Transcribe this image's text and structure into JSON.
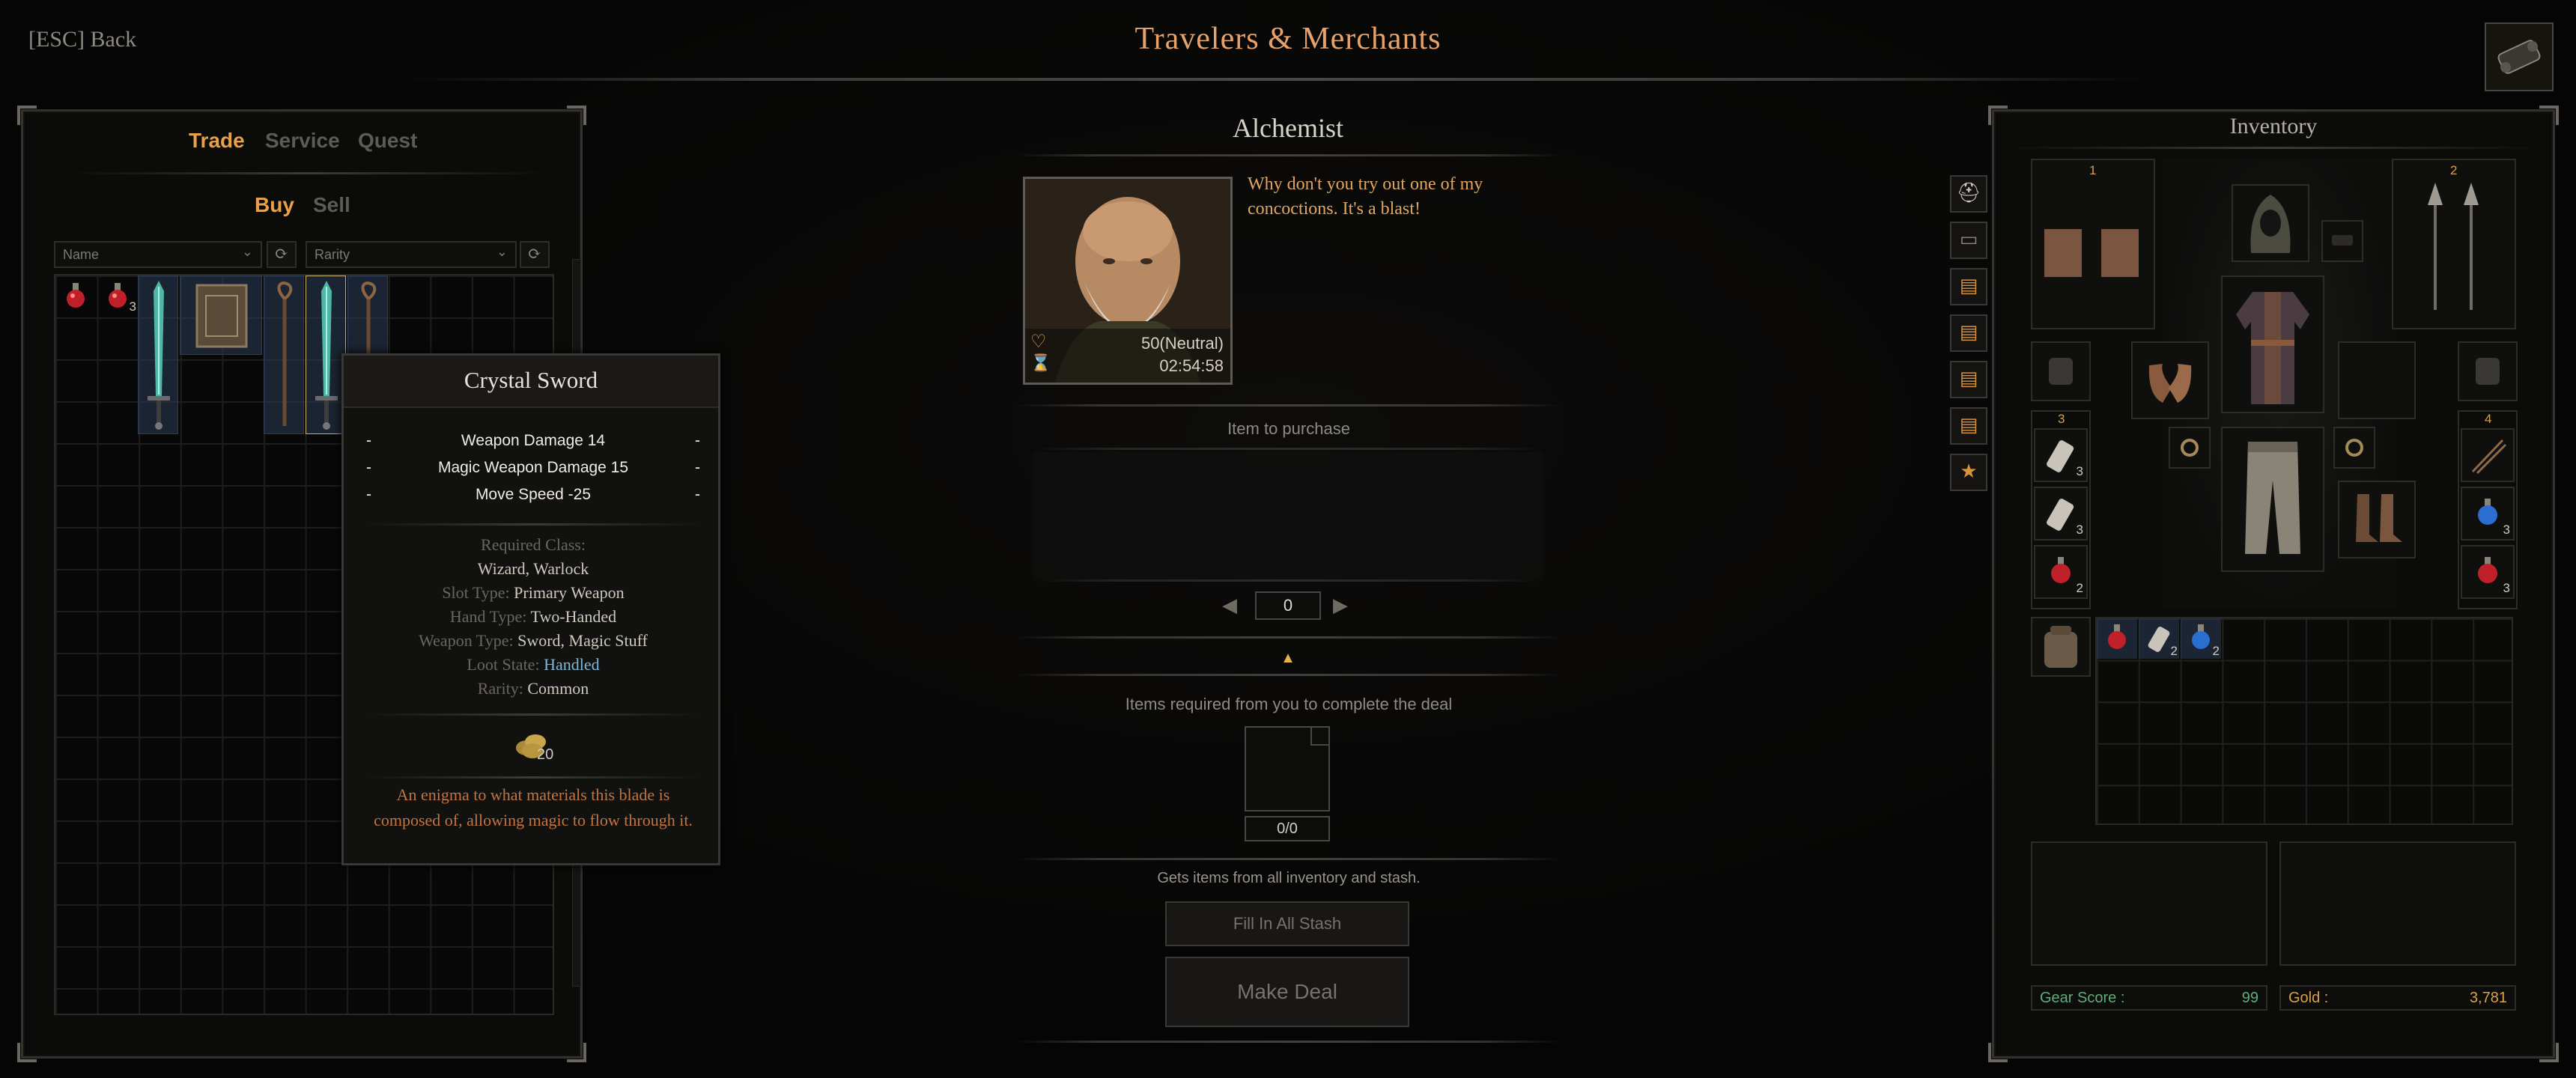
{
  "header": {
    "back_label": "[ESC] Back",
    "title": "Travelers & Merchants"
  },
  "left_panel": {
    "tabs": [
      {
        "label": "Trade",
        "active": true
      },
      {
        "label": "Service"
      },
      {
        "label": "Quest"
      }
    ],
    "subtabs": [
      {
        "label": "Buy",
        "active": true
      },
      {
        "label": "Sell"
      }
    ],
    "filter_name": "Name",
    "filter_rarity": "Rarity",
    "items": [
      {
        "icon": "red-potion-icon"
      },
      {
        "icon": "red-potion-icon",
        "count": "3"
      },
      {
        "icon": "crystal-sword-icon"
      },
      {
        "icon": "spellbook-icon"
      },
      {
        "icon": "staff-icon"
      },
      {
        "icon": "crystal-sword-icon"
      },
      {
        "icon": "staff-icon"
      }
    ]
  },
  "tooltip": {
    "title": "Crystal Sword",
    "stats": [
      "Weapon Damage 14",
      "Magic Weapon Damage 15",
      "Move Speed -25"
    ],
    "required_class_label": "Required Class:",
    "required_class_value": "Wizard, Warlock",
    "rows": [
      {
        "label": "Slot Type:",
        "value": "Primary Weapon"
      },
      {
        "label": "Hand Type:",
        "value": "Two-Handed"
      },
      {
        "label": "Weapon Type:",
        "value": "Sword, Magic Stuff"
      },
      {
        "label": "Loot State:",
        "value": "Handled",
        "color": "#7fb7d6"
      },
      {
        "label": "Rarity:",
        "value": "Common"
      }
    ],
    "price": "20",
    "description": "An enigma to what materials this blade is composed of, allowing magic to flow through it."
  },
  "merchant": {
    "name": "Alchemist",
    "dialogue": "Why don't you try out one of my concoctions. It's a blast!",
    "affinity": "50(Neutral)",
    "timer": "02:54:58",
    "item_to_purchase_label": "Item to purchase",
    "quantity": "0",
    "required_label": "Items required from you to complete the deal",
    "required_count": "0/0",
    "source_note": "Gets items from all inventory and stash.",
    "fill_button": "Fill In All Stash",
    "deal_button": "Make Deal"
  },
  "inventory": {
    "title": "Inventory",
    "weapon_slot_1": "1",
    "weapon_slot_2": "2",
    "utility_left_label": "3",
    "utility_right_label": "4",
    "utility_left": [
      {
        "icon": "bandage-icon",
        "count": "3"
      },
      {
        "icon": "bandage-icon",
        "count": "3"
      },
      {
        "icon": "red-potion-icon",
        "count": "2"
      }
    ],
    "utility_right": [
      {
        "icon": "arrows-icon"
      },
      {
        "icon": "blue-potion-icon",
        "count": "3"
      },
      {
        "icon": "red-potion-icon",
        "count": "3"
      }
    ],
    "bag_items": [
      {
        "icon": "red-potion-icon"
      },
      {
        "icon": "bandage-icon",
        "count": "2"
      },
      {
        "icon": "blue-potion-icon",
        "count": "2"
      }
    ],
    "gear_score_label": "Gear Score :",
    "gear_score": "99",
    "gold_label": "Gold :",
    "gold": "3,781"
  },
  "colors": {
    "accent": "#e6a26a",
    "tab_active": "#e8a04a",
    "dialogue": "#e2a55e",
    "gear_score": "#5fae7a",
    "gold": "#d9a14a",
    "description": "#c4743e"
  }
}
